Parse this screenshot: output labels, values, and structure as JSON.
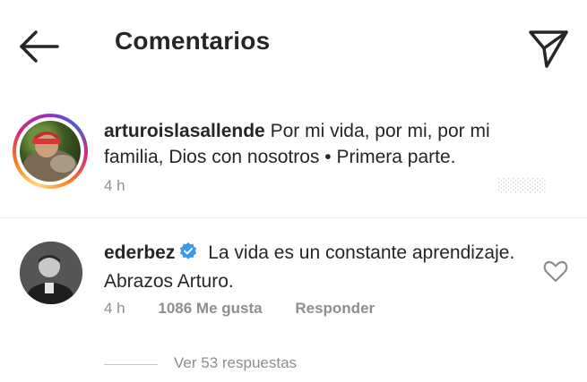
{
  "header": {
    "title": "Comentarios",
    "back_icon": "arrow-left-icon",
    "send_icon": "paper-plane-icon"
  },
  "comments": [
    {
      "username": "arturoislasallende",
      "text": "Por mi vida, por mi, por mi familia, Dios con nosotros • Primera parte.",
      "time": "4 h",
      "has_story_ring": true
    },
    {
      "username": "ederbez",
      "verified": true,
      "text": "La vida es un constante aprendizaje. Abrazos Arturo.",
      "time": "4 h",
      "likes": "1086 Me gusta",
      "reply_label": "Responder",
      "view_replies": "Ver 53 respuestas"
    }
  ],
  "colors": {
    "text": "#262626",
    "muted": "#8e8e8e",
    "verified": "#3897f0"
  }
}
